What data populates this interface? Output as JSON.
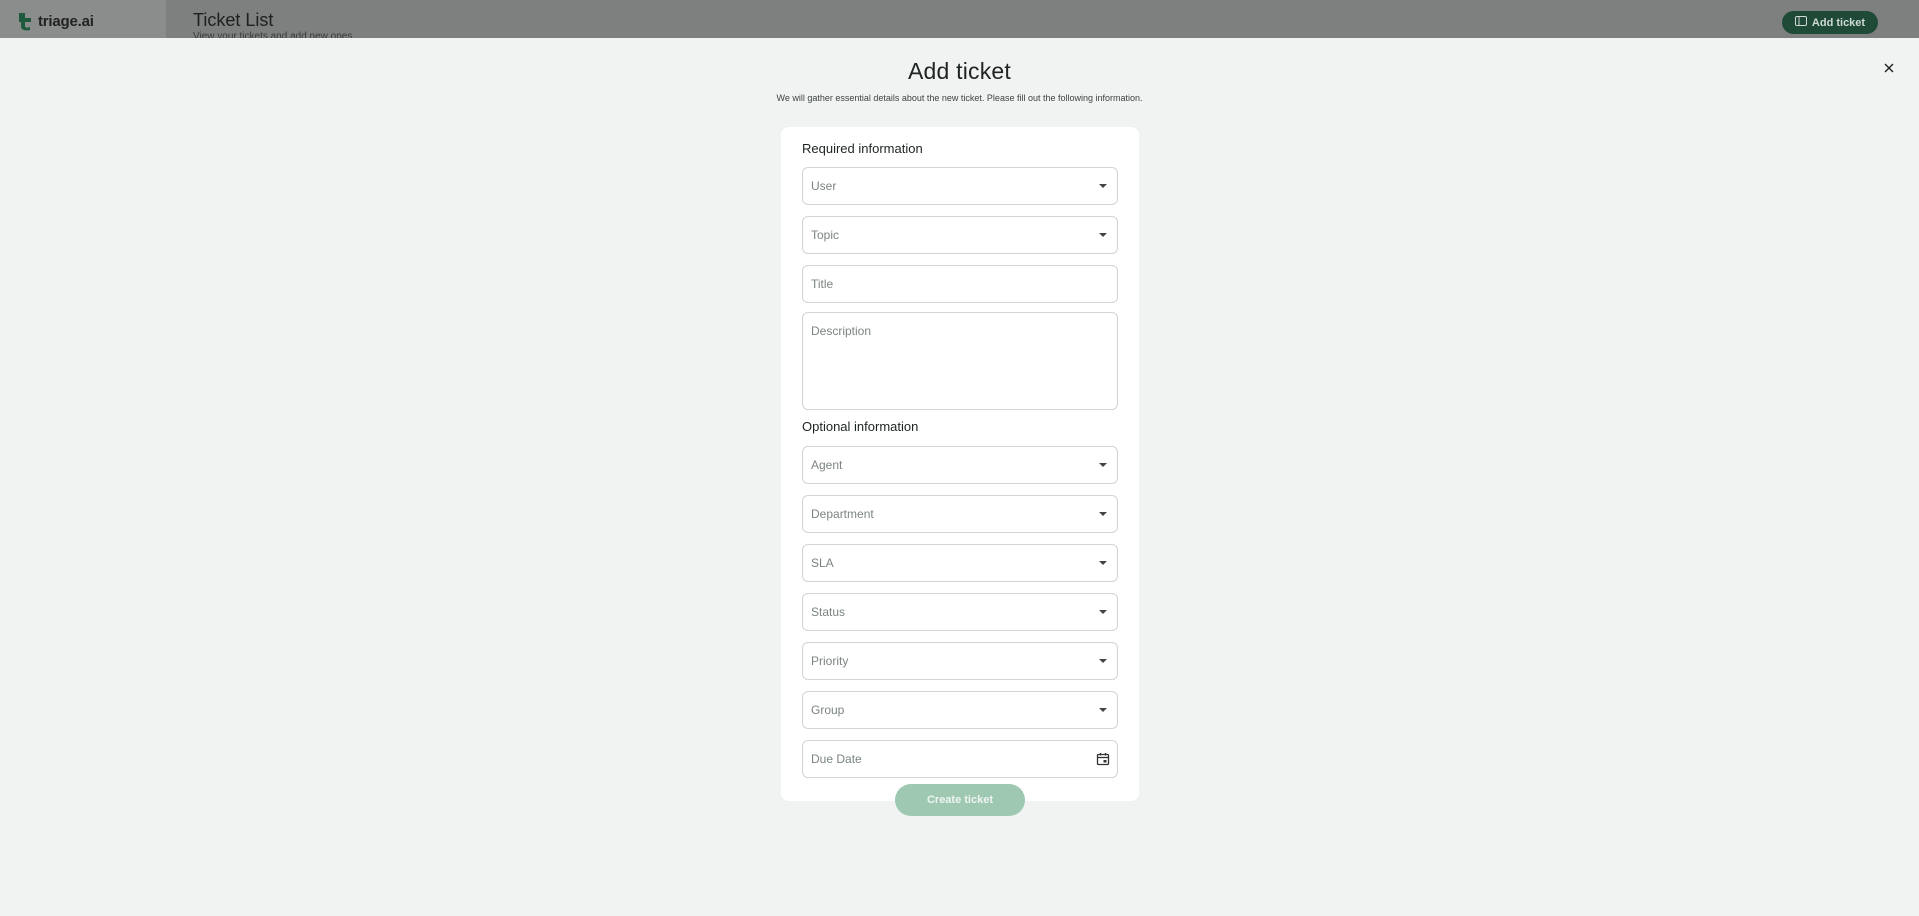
{
  "app": {
    "logo_text": "triage.ai",
    "page_title": "Ticket List",
    "page_subtitle": "View your tickets and add new ones",
    "add_ticket_label": "Add ticket"
  },
  "modal": {
    "title": "Add ticket",
    "subtitle": "We will gather essential details about the new ticket. Please fill out the following information.",
    "required_label": "Required information",
    "optional_label": "Optional information",
    "fields": {
      "user": "User",
      "topic": "Topic",
      "title": "Title",
      "description": "Description",
      "agent": "Agent",
      "department": "Department",
      "sla": "SLA",
      "status": "Status",
      "priority": "Priority",
      "group": "Group",
      "due_date": "Due Date"
    },
    "create_label": "Create ticket"
  },
  "colors": {
    "brand_dark": "#1f4a37",
    "create_disabled": "#9fc8b3",
    "modal_bg": "#f1f3f2"
  }
}
